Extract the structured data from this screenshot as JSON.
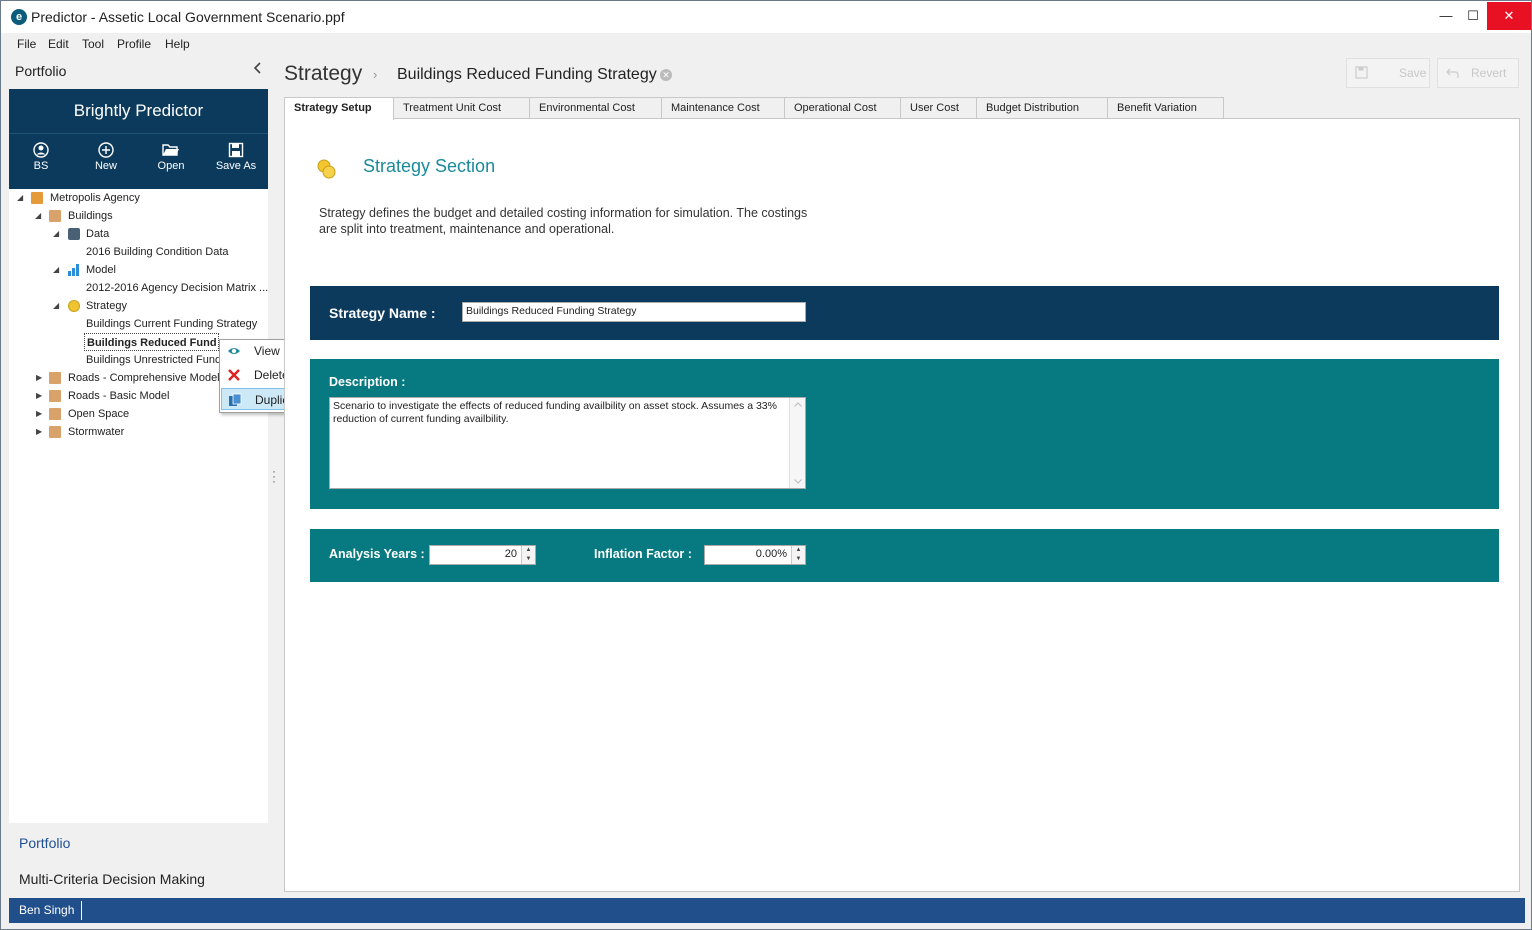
{
  "window": {
    "title": "Predictor - Assetic Local Government Scenario.ppf",
    "controls": {
      "minimize": "—",
      "maximize": "☐",
      "close": "✕"
    }
  },
  "menu": [
    "File",
    "Edit",
    "Tool",
    "Profile",
    "Help"
  ],
  "left_panel": {
    "header": "Portfolio",
    "brand": "Brightly Predictor",
    "toolbar": [
      {
        "label": "BS",
        "icon": "user-icon"
      },
      {
        "label": "New",
        "icon": "plus-circle-icon"
      },
      {
        "label": "Open",
        "icon": "folder-open-icon"
      },
      {
        "label": "Save As",
        "icon": "save-icon"
      }
    ],
    "tree": {
      "agency": "Metropolis Agency",
      "buildings": "Buildings",
      "data": "Data",
      "data_item": "2016 Building Condition Data",
      "model": "Model",
      "model_item": "2012-2016 Agency Decision Matrix ...",
      "strategy": "Strategy",
      "strategy_items": [
        "Buildings Current Funding Strategy",
        "Buildings Reduced Fund",
        "Buildings Unrestricted Fundi"
      ],
      "roads_comprehensive": "Roads - Comprehensive Model",
      "roads_basic": "Roads - Basic Model",
      "open_space": "Open Space",
      "stormwater": "Stormwater"
    },
    "nav": {
      "portfolio": "Portfolio",
      "mcdm": "Multi-Criteria Decision Making"
    }
  },
  "context_menu": {
    "items": [
      {
        "label": "View",
        "icon": "eye-icon"
      },
      {
        "label": "Delete",
        "icon": "delete-x-icon"
      },
      {
        "label": "Duplicate",
        "icon": "duplicate-icon"
      }
    ]
  },
  "main": {
    "title": "Strategy",
    "breadcrumb": "Buildings Reduced Funding Strategy",
    "save_label": "Save",
    "revert_label": "Revert",
    "tabs": [
      "Strategy Setup",
      "Treatment Unit Cost",
      "Environmental Cost",
      "Maintenance Cost",
      "Operational Cost",
      "User Cost",
      "Budget Distribution",
      "Benefit Variation"
    ],
    "section_title": "Strategy Section",
    "section_desc": "Strategy defines the budget and detailed costing information for simulation. The costings are split into treatment, maintenance and operational.",
    "strategy_name_label": "Strategy Name :",
    "strategy_name_value": "Buildings Reduced Funding Strategy",
    "description_label": "Description :",
    "description_value": "Scenario to investigate the effects of reduced funding availbility on asset stock. Assumes a 33% reduction of current funding availbility.",
    "analysis_years_label": "Analysis Years :",
    "analysis_years_value": "20",
    "inflation_label": "Inflation Factor :",
    "inflation_value": "0.00%"
  },
  "status": {
    "user": "Ben Singh"
  },
  "colors": {
    "navy": "#0b3a5c",
    "teal": "#067a80",
    "status_blue": "#214f8c",
    "accent_teal_text": "#1a8a9a"
  }
}
